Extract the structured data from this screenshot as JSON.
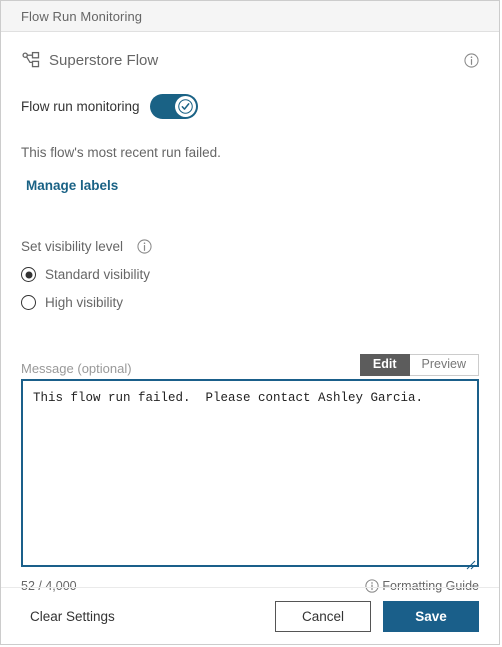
{
  "window": {
    "title": "Flow Run Monitoring"
  },
  "flow": {
    "icon": "flow-diagram-icon",
    "name": "Superstore Flow",
    "info_icon": "info-icon"
  },
  "monitoring": {
    "label": "Flow run monitoring",
    "enabled": true,
    "toggle_icon": "check-icon",
    "status_text": "This flow's most recent run failed.",
    "manage_labels_link": "Manage labels"
  },
  "visibility": {
    "heading": "Set visibility level",
    "info_icon": "info-icon",
    "selected": "standard",
    "options": [
      {
        "id": "standard",
        "label": "Standard visibility",
        "checked": true
      },
      {
        "id": "high",
        "label": "High visibility",
        "checked": false
      }
    ]
  },
  "message": {
    "label": "Message (optional)",
    "tabs": [
      {
        "id": "edit",
        "label": "Edit",
        "active": true
      },
      {
        "id": "preview",
        "label": "Preview",
        "active": false
      }
    ],
    "value": "This flow run failed.  Please contact Ashley Garcia.",
    "placeholder": "",
    "char_count": "52 / 4,000",
    "formatting_guide": "Formatting Guide",
    "formatting_guide_icon": "info-icon",
    "resize_handle_icon": "resize-handle-icon"
  },
  "footer": {
    "clear_settings": "Clear Settings",
    "cancel": "Cancel",
    "save": "Save"
  },
  "colors": {
    "accent_blue": "#1a5f8a",
    "toggle_on": "#1a6285",
    "link_blue": "#1a6285",
    "tab_active_bg": "#5c5c5c",
    "header_bg": "#f5f5f5"
  }
}
